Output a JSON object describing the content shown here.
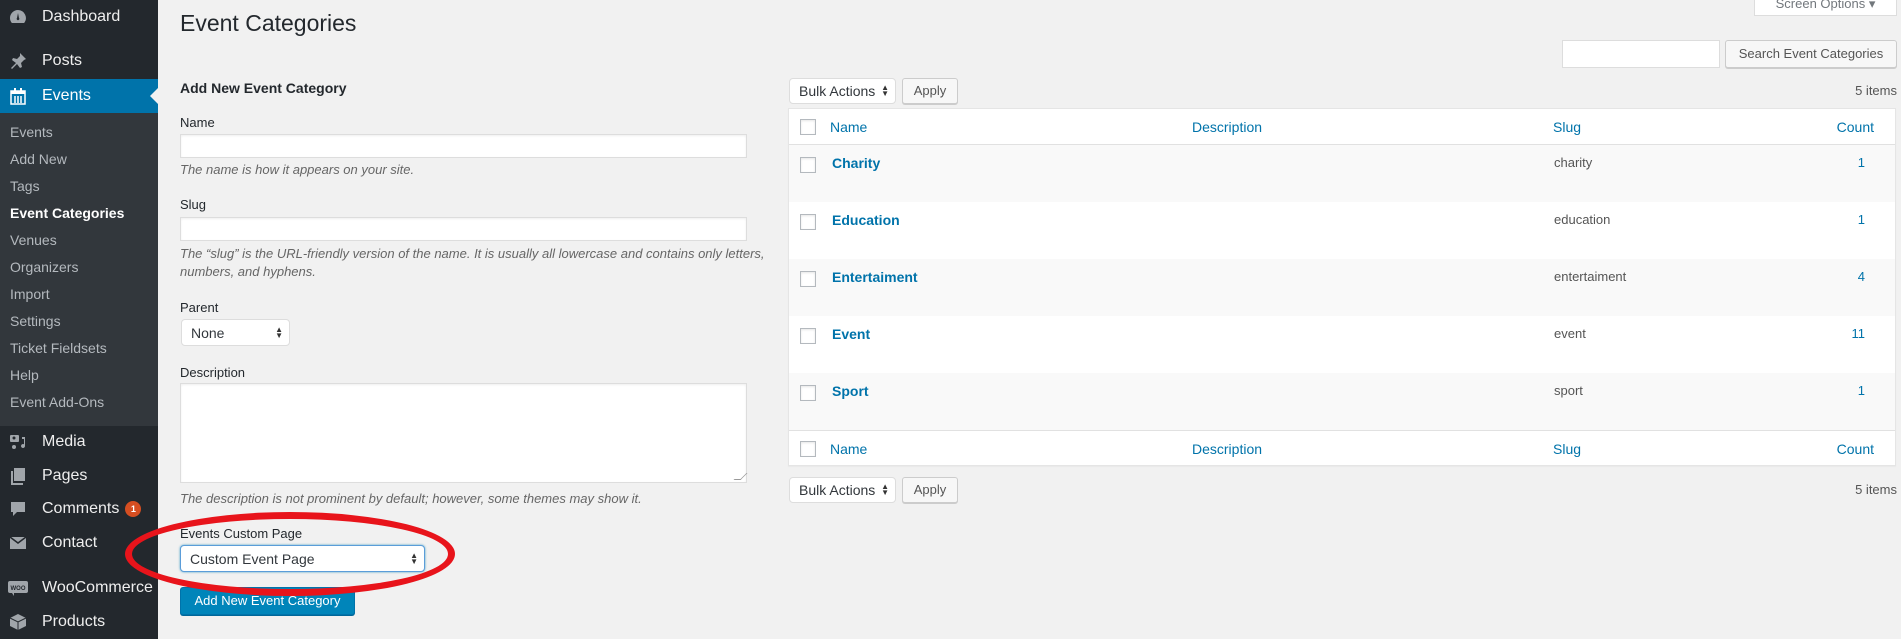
{
  "sidebar": {
    "top_items": [
      {
        "label": "Dashboard",
        "icon": "dashboard-icon"
      },
      {
        "label": "Posts",
        "icon": "pin-icon"
      },
      {
        "label": "Events",
        "icon": "calendar-icon",
        "active": true
      }
    ],
    "submenu": [
      {
        "label": "Events"
      },
      {
        "label": "Add New"
      },
      {
        "label": "Tags"
      },
      {
        "label": "Event Categories",
        "current": true
      },
      {
        "label": "Venues"
      },
      {
        "label": "Organizers"
      },
      {
        "label": "Import"
      },
      {
        "label": "Settings"
      },
      {
        "label": "Ticket Fieldsets"
      },
      {
        "label": "Help"
      },
      {
        "label": "Event Add-Ons"
      }
    ],
    "bottom_items": [
      {
        "label": "Media",
        "icon": "media-icon"
      },
      {
        "label": "Pages",
        "icon": "pages-icon"
      },
      {
        "label": "Comments",
        "icon": "comment-icon",
        "badge": "1"
      },
      {
        "label": "Contact",
        "icon": "envelope-icon"
      },
      {
        "label": "WooCommerce",
        "icon": "woocommerce-icon"
      },
      {
        "label": "Products",
        "icon": "box-icon"
      }
    ]
  },
  "header": {
    "title": "Event Categories",
    "screen_options": "Screen Options ▾"
  },
  "form": {
    "heading": "Add New Event Category",
    "name_label": "Name",
    "name_value": "",
    "name_hint": "The name is how it appears on your site.",
    "slug_label": "Slug",
    "slug_value": "",
    "slug_hint": "The “slug” is the URL-friendly version of the name. It is usually all lowercase and contains only letters, numbers, and hyphens.",
    "parent_label": "Parent",
    "parent_value": "None",
    "description_label": "Description",
    "description_value": "",
    "description_hint": "The description is not prominent by default; however, some themes may show it.",
    "custom_page_label": "Events Custom Page",
    "custom_page_value": "Custom Event Page",
    "submit_label": "Add New Event Category"
  },
  "list": {
    "search_value": "",
    "search_button": "Search Event Categories",
    "bulk_actions": "Bulk Actions",
    "apply": "Apply",
    "items_count": "5 items",
    "columns": {
      "name": "Name",
      "description": "Description",
      "slug": "Slug",
      "count": "Count"
    },
    "rows": [
      {
        "name": "Charity",
        "description": "",
        "slug": "charity",
        "count": "1"
      },
      {
        "name": "Education",
        "description": "",
        "slug": "education",
        "count": "1"
      },
      {
        "name": "Entertaiment",
        "description": "",
        "slug": "entertaiment",
        "count": "4"
      },
      {
        "name": "Event",
        "description": "",
        "slug": "event",
        "count": "11"
      },
      {
        "name": "Sport",
        "description": "",
        "slug": "sport",
        "count": "1"
      }
    ]
  },
  "colors": {
    "sidebar_bg": "#23282d",
    "submenu_bg": "#32373c",
    "accent": "#0073aa",
    "primary_button": "#0085ba",
    "annotation": "#e8141b",
    "badge": "#d54e21"
  }
}
